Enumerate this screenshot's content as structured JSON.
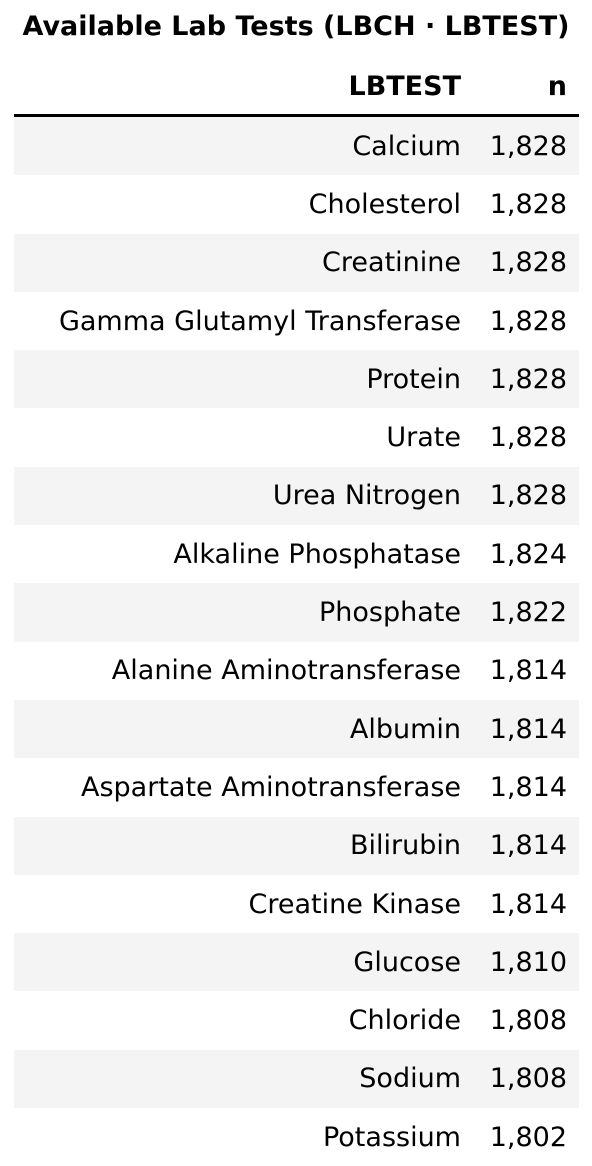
{
  "chart_data": {
    "type": "table",
    "title": "Available Lab Tests (LBCH · LBTEST)",
    "columns": [
      "LBTEST",
      "n"
    ],
    "rows": [
      {
        "test": "Calcium",
        "n": "1,828"
      },
      {
        "test": "Cholesterol",
        "n": "1,828"
      },
      {
        "test": "Creatinine",
        "n": "1,828"
      },
      {
        "test": "Gamma Glutamyl Transferase",
        "n": "1,828"
      },
      {
        "test": "Protein",
        "n": "1,828"
      },
      {
        "test": "Urate",
        "n": "1,828"
      },
      {
        "test": "Urea Nitrogen",
        "n": "1,828"
      },
      {
        "test": "Alkaline Phosphatase",
        "n": "1,824"
      },
      {
        "test": "Phosphate",
        "n": "1,822"
      },
      {
        "test": "Alanine Aminotransferase",
        "n": "1,814"
      },
      {
        "test": "Albumin",
        "n": "1,814"
      },
      {
        "test": "Aspartate Aminotransferase",
        "n": "1,814"
      },
      {
        "test": "Bilirubin",
        "n": "1,814"
      },
      {
        "test": "Creatine Kinase",
        "n": "1,814"
      },
      {
        "test": "Glucose",
        "n": "1,810"
      },
      {
        "test": "Chloride",
        "n": "1,808"
      },
      {
        "test": "Sodium",
        "n": "1,808"
      },
      {
        "test": "Potassium",
        "n": "1,802"
      }
    ]
  },
  "colors": {
    "stripe": "#f4f4f4",
    "rule": "#000000"
  }
}
